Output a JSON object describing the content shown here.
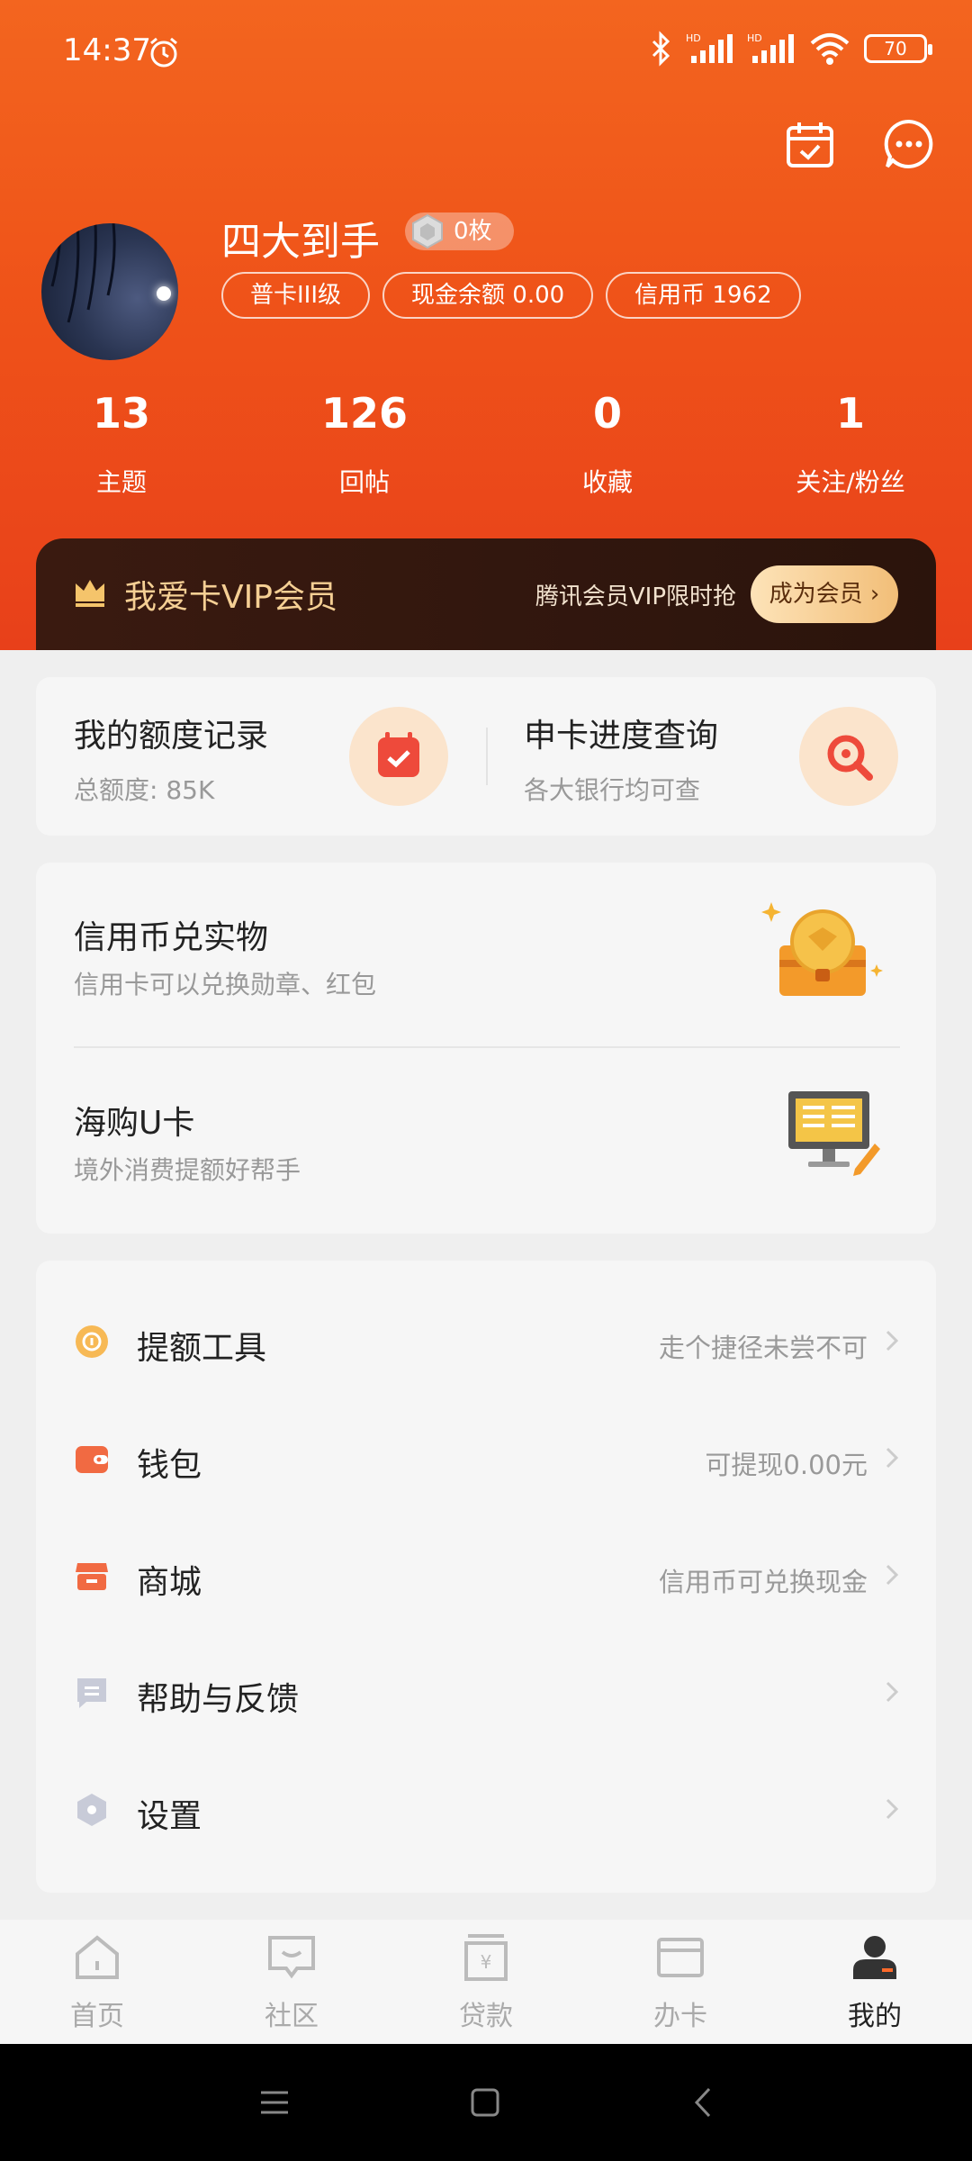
{
  "status_bar": {
    "time": "14:37",
    "battery": "70"
  },
  "profile": {
    "username": "四大到手",
    "badge_count": "0枚",
    "chips": [
      "普卡III级",
      "现金余额 0.00",
      "信用币 1962"
    ]
  },
  "stats": [
    {
      "value": "13",
      "label": "主题"
    },
    {
      "value": "126",
      "label": "回帖"
    },
    {
      "value": "0",
      "label": "收藏"
    },
    {
      "value": "1",
      "label": "关注/粉丝"
    }
  ],
  "vip": {
    "title": "我爱卡VIP会员",
    "promo": "腾讯会员VIP限时抢",
    "button": "成为会员"
  },
  "quota_card": {
    "left_title": "我的额度记录",
    "left_sub": "总额度: 85K",
    "right_title": "申卡进度查询",
    "right_sub": "各大银行均可查"
  },
  "feature_card": [
    {
      "title": "信用币兑实物",
      "sub": "信用卡可以兑换勋章、红包"
    },
    {
      "title": "海购U卡",
      "sub": "境外消费提额好帮手"
    }
  ],
  "menu": [
    {
      "label": "提额工具",
      "hint": "走个捷径未尝不可"
    },
    {
      "label": "钱包",
      "hint": "可提现0.00元"
    },
    {
      "label": "商城",
      "hint": "信用币可兑换现金"
    },
    {
      "label": "帮助与反馈",
      "hint": ""
    },
    {
      "label": "设置",
      "hint": ""
    }
  ],
  "tabs": [
    "首页",
    "社区",
    "贷款",
    "办卡",
    "我的"
  ],
  "colors": {
    "brand_orange": "#ef5319",
    "vip_gold": "#f5cf94",
    "active_tab": "#222222"
  }
}
